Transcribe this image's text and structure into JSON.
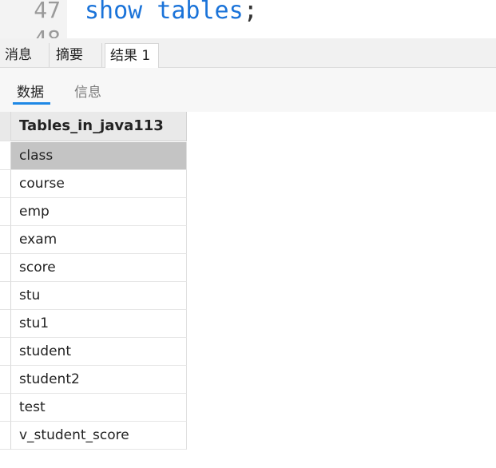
{
  "editor": {
    "line_numbers": [
      "47",
      "48"
    ],
    "code_keyword_1": "show",
    "code_keyword_2": "tables",
    "code_terminator": ";"
  },
  "result_tabs": {
    "messages": "消息",
    "summary": "摘要",
    "result": "结果 1"
  },
  "sub_tabs": {
    "data": "数据",
    "info": "信息"
  },
  "table": {
    "column_header": "Tables_in_java113",
    "rows": [
      "class",
      "course",
      "emp",
      "exam",
      "score",
      "stu",
      "stu1",
      "student",
      "student2",
      "test",
      "v_student_score"
    ],
    "selected_row": "class"
  },
  "colors": {
    "keyword": "#1a73d9",
    "accent_underline": "#1e88e5",
    "selected_row": "#c4c4c4"
  }
}
